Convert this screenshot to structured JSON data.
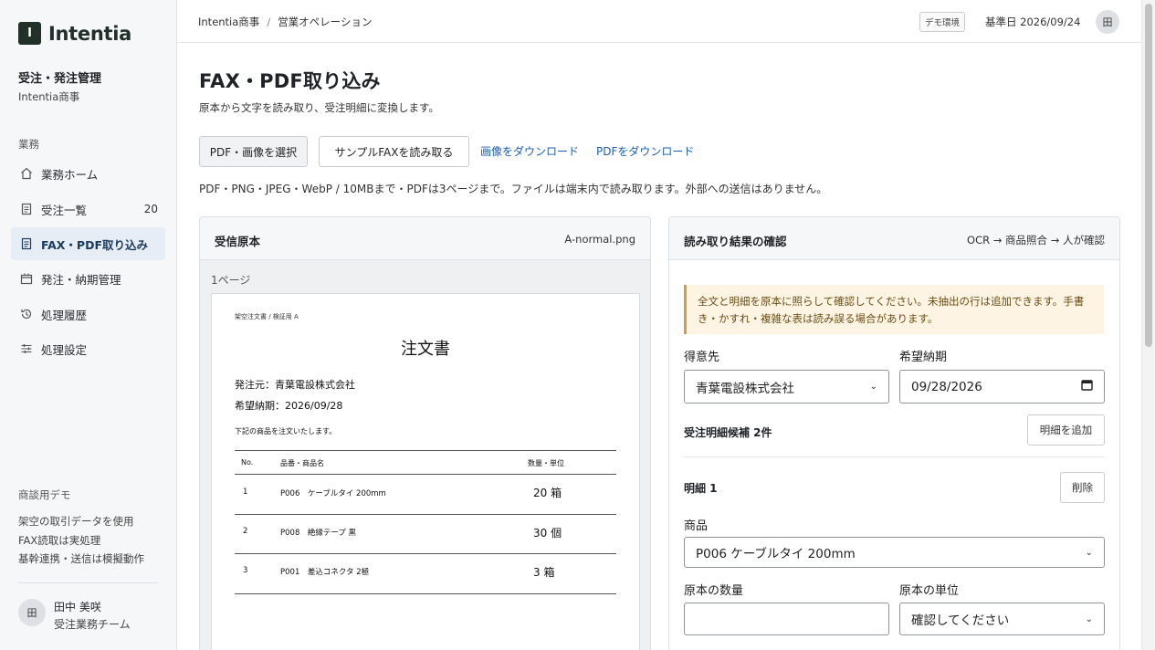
{
  "app": {
    "logo_mark": "I",
    "logo_text": "Intentia",
    "org_title": "受注・発注管理",
    "org_sub": "Intentia商事"
  },
  "sidebar": {
    "section_label": "業務",
    "items": [
      {
        "label": "業務ホーム",
        "icon": "home-icon",
        "count": ""
      },
      {
        "label": "受注一覧",
        "icon": "document-icon",
        "count": "20"
      },
      {
        "label": "FAX・PDF取り込み",
        "icon": "document-icon",
        "count": ""
      },
      {
        "label": "発注・納期管理",
        "icon": "box-icon",
        "count": ""
      },
      {
        "label": "処理履歴",
        "icon": "history-icon",
        "count": ""
      },
      {
        "label": "処理設定",
        "icon": "sliders-icon",
        "count": ""
      }
    ],
    "demo_title": "商談用デモ",
    "demo_notes": [
      "架空の取引データを使用",
      "FAX読取は実処理",
      "基幹連携・送信は模擬動作"
    ],
    "user": {
      "avatar": "田",
      "name": "田中 美咲",
      "team": "受注業務チーム"
    }
  },
  "header": {
    "breadcrumb": [
      "Intentia商事",
      "営業オペレーション"
    ],
    "breadcrumb_sep": "/",
    "env_badge": "デモ環境",
    "base_date": "基準日 2026/09/24",
    "avatar": "田"
  },
  "main": {
    "title": "FAX・PDF取り込み",
    "description": "原本から文字を読み取り、受注明細に変換します。",
    "buttons": {
      "select": "PDF・画像を選択",
      "sample": "サンプルFAXを読み取る"
    },
    "links": {
      "image_download": "画像をダウンロード",
      "pdf_download": "PDFをダウンロード"
    },
    "file_note": "PDF・PNG・JPEG・WebP / 10MBまで・PDFは3ページまで。ファイルは端末内で読み取ります。外部への送信はありません。"
  },
  "source_panel": {
    "title": "受信原本",
    "filename": "A-normal.png",
    "page_label": "1ページ",
    "doc": {
      "small_header": "架空注文書 / 検証用 A",
      "title": "注文書",
      "orderer": "発注元：青葉電設株式会社",
      "delivery": "希望納期：2026/09/28",
      "note": "下記の商品を注文いたします。",
      "columns": [
        "No.",
        "品番・商品名",
        "数量・単位"
      ],
      "rows": [
        {
          "no": "1",
          "item": "P006　ケーブルタイ 200mm",
          "qty": "20 箱"
        },
        {
          "no": "2",
          "item": "P008　絶縁テープ 黒",
          "qty": "30 個"
        },
        {
          "no": "3",
          "item": "P001　差込コネクタ 2極",
          "qty": "3 箱"
        }
      ]
    }
  },
  "result_panel": {
    "title": "読み取り結果の確認",
    "flow": "OCR → 商品照合 → 人が確認",
    "notice": "全文と明細を原本に照らして確認してください。未抽出の行は追加できます。手書き・かすれ・複雑な表は読み誤る場合があります。",
    "customer_label": "得意先",
    "customer_value": "青葉電設株式会社",
    "date_label": "希望納期",
    "date_value": "09/28/2026",
    "lines_title": "受注明細候補 2件",
    "add_line_button": "明細を追加",
    "line1": {
      "title": "明細 1",
      "delete_button": "削除",
      "product_label": "商品",
      "product_value": "P006 ケーブルタイ 200mm",
      "qty_label": "原本の数量",
      "qty_value": "",
      "unit_label": "原本の単位",
      "unit_value": "確認してください"
    }
  }
}
